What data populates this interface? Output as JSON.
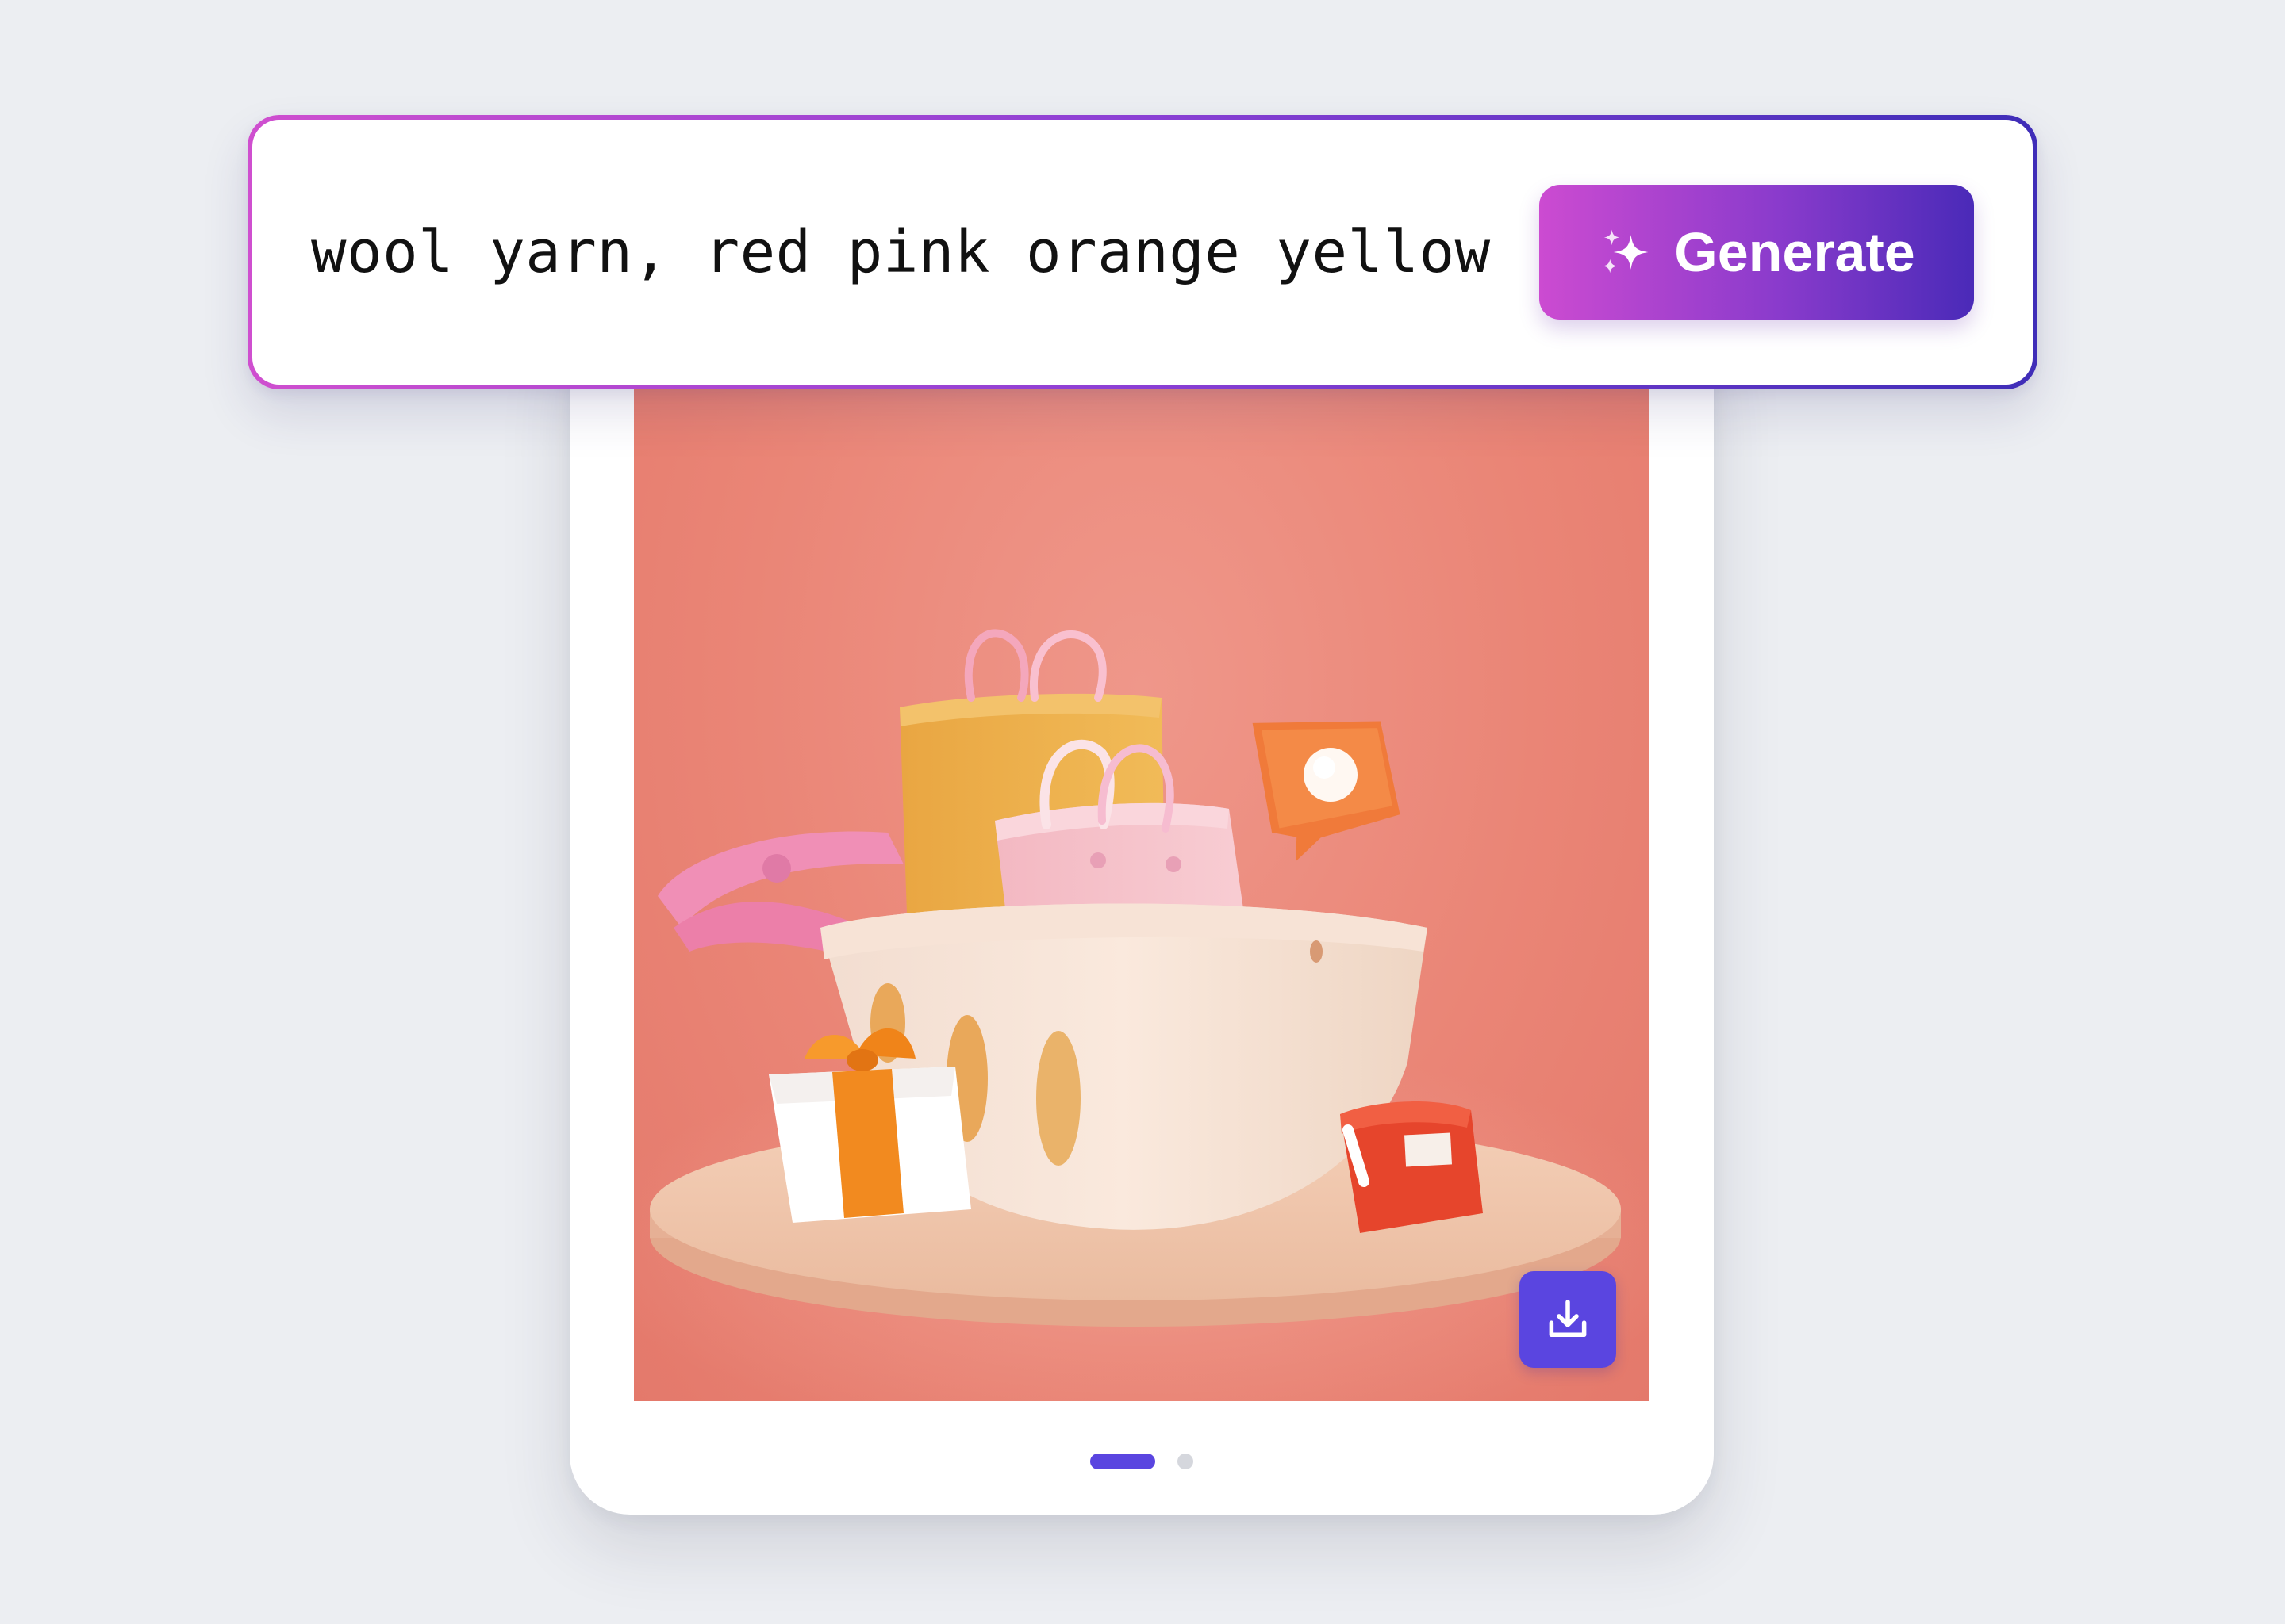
{
  "prompt": {
    "value": "wool yarn, red pink orange yellow"
  },
  "generate_button": {
    "label": "Generate",
    "icon": "sparkle-icon"
  },
  "result": {
    "image_description_icon": "felt-shopping-basket-image",
    "download_icon": "download-icon",
    "pager": {
      "total": 2,
      "active": 1
    }
  },
  "colors": {
    "background": "#eceef2",
    "accent": "#5a45e0",
    "gradient_start": "#cf4fcf",
    "gradient_end": "#3f2db8",
    "image_background": "#ea8576"
  }
}
